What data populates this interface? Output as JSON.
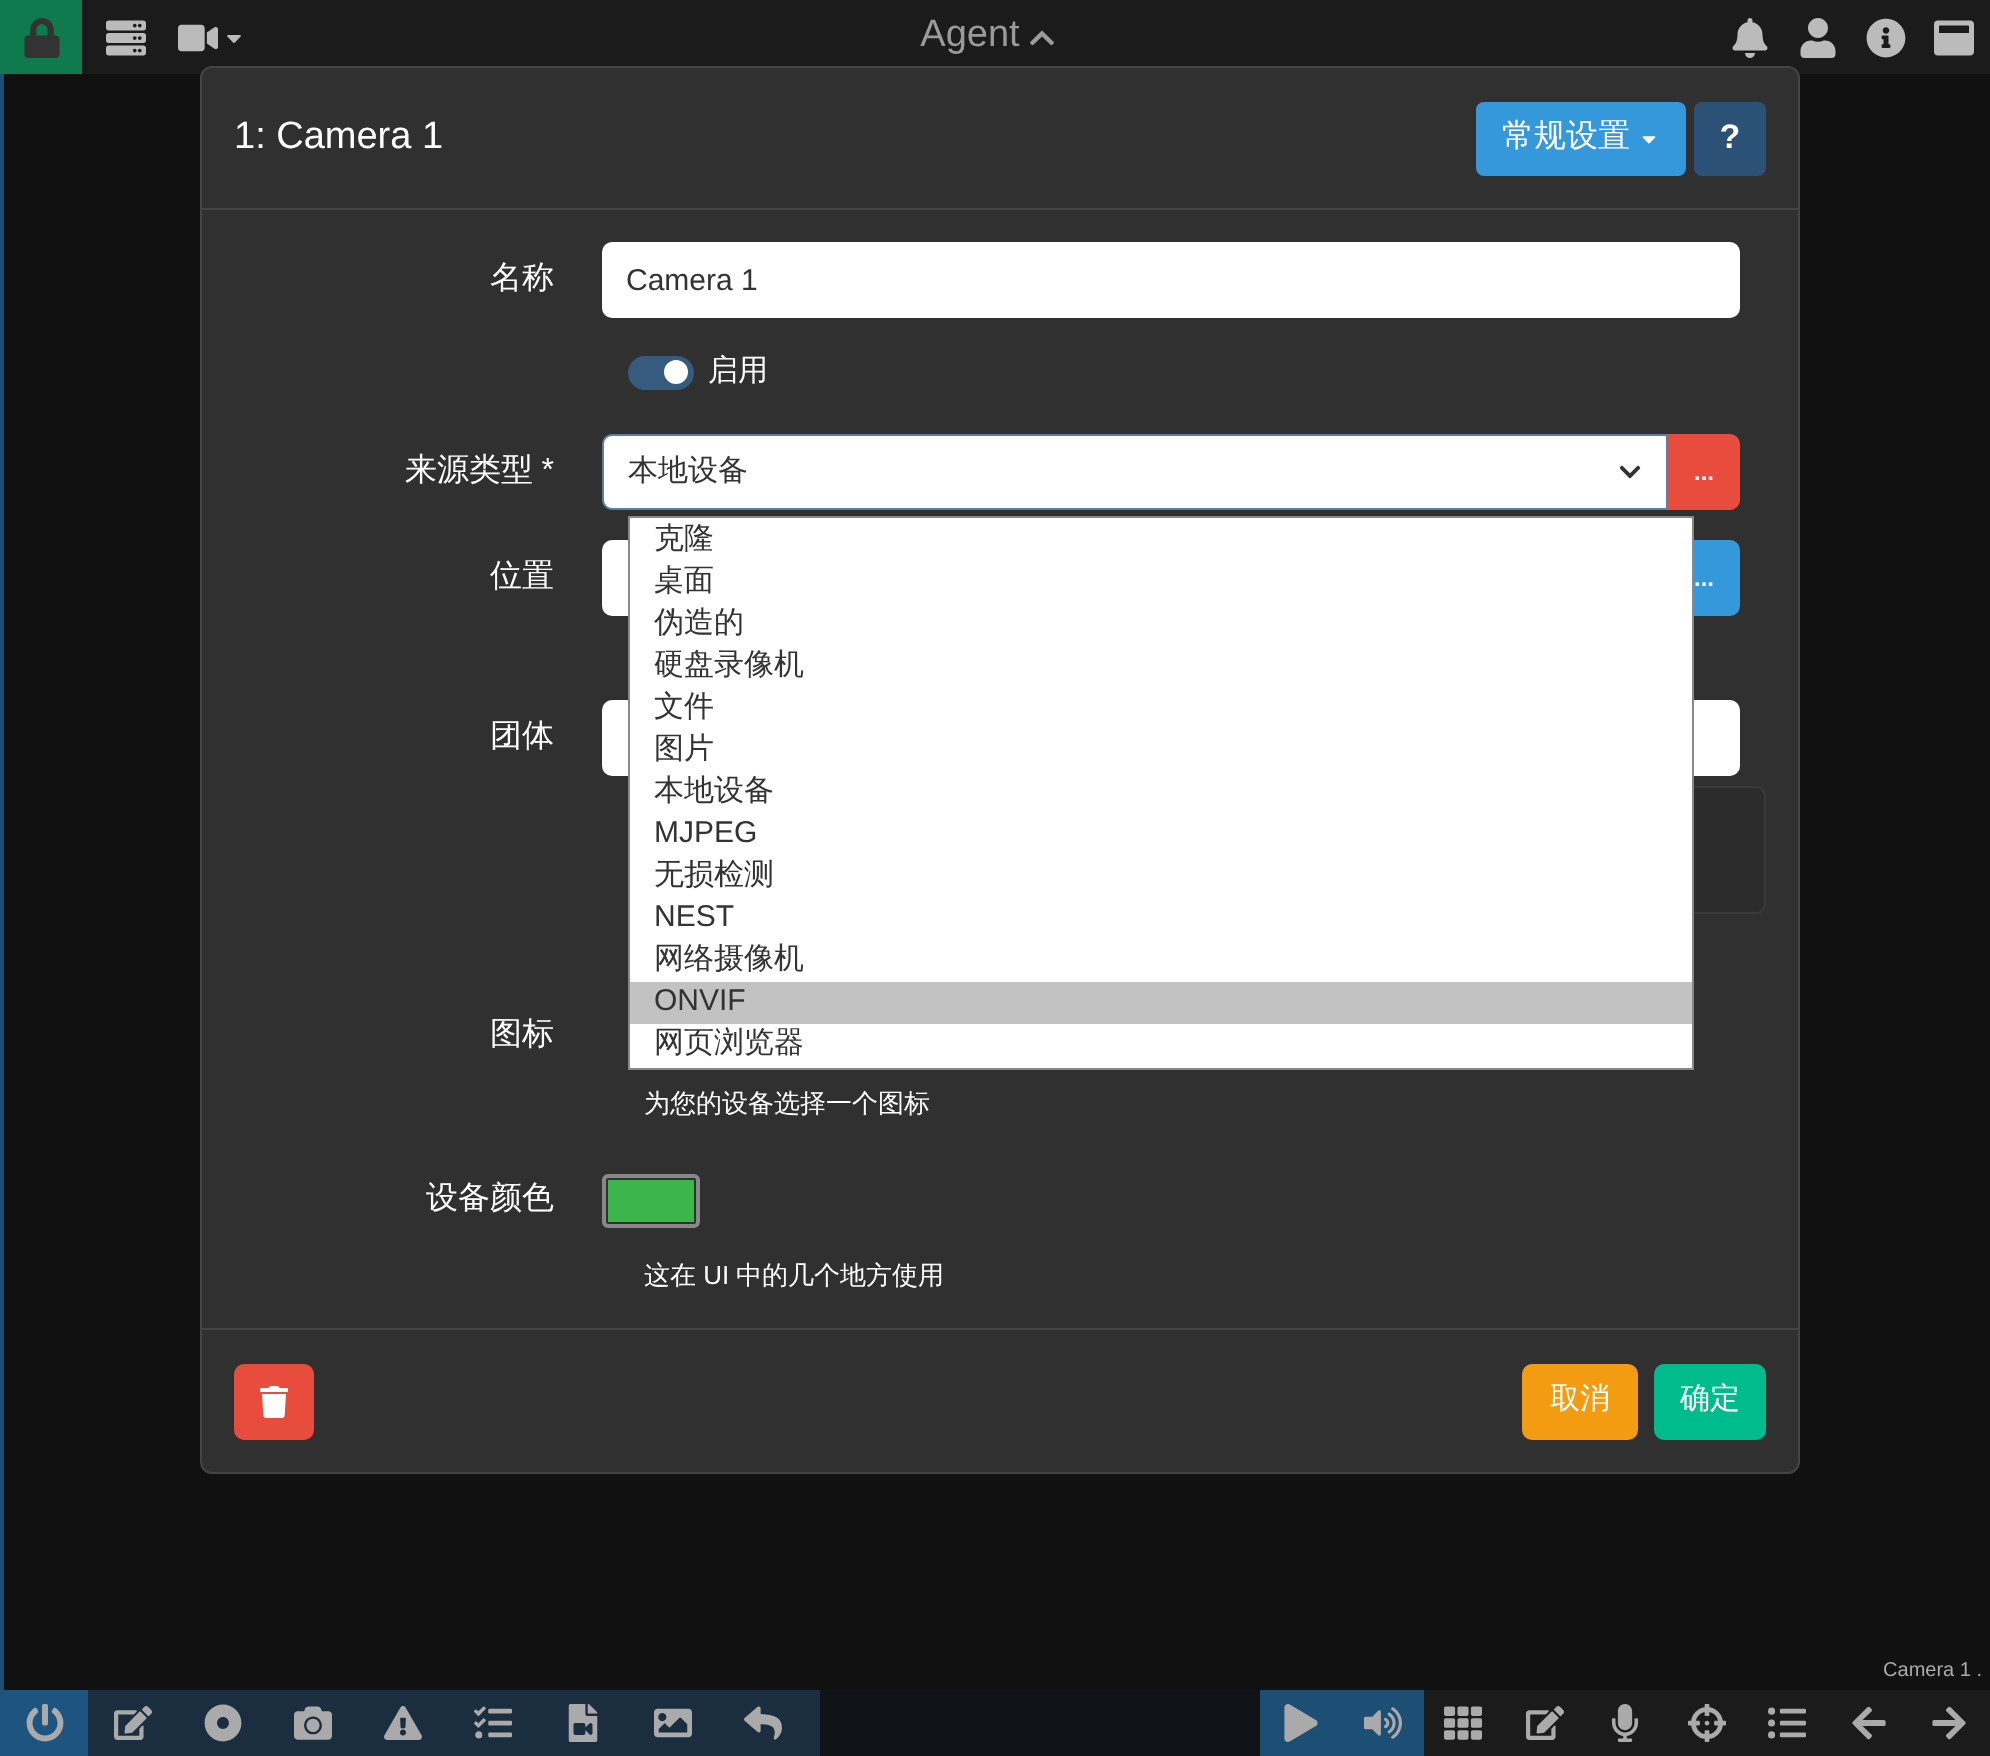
{
  "top_bar": {
    "title": "Agent"
  },
  "dialog": {
    "title": "1: Camera 1",
    "settings_button": "常规设置",
    "help_button": "?",
    "name": {
      "label": "名称",
      "value": "Camera 1"
    },
    "enabled": {
      "label": "启用",
      "on": true
    },
    "source": {
      "label": "来源类型 *",
      "value": "本地设备",
      "more_button": "..."
    },
    "location": {
      "label": "位置",
      "more_button": "..."
    },
    "group": {
      "label": "团体"
    },
    "icon": {
      "label": "图标",
      "hint": "为您的设备选择一个图标"
    },
    "color": {
      "label": "设备颜色",
      "color": "#3cb54a",
      "hint": "这在 UI 中的几个地方使用"
    },
    "cancel_button": "取消",
    "ok_button": "确定"
  },
  "dropdown": [
    {
      "label": "克隆",
      "selected": false
    },
    {
      "label": "桌面",
      "selected": false
    },
    {
      "label": "伪造的",
      "selected": false
    },
    {
      "label": "硬盘录像机",
      "selected": false
    },
    {
      "label": "文件",
      "selected": false
    },
    {
      "label": "图片",
      "selected": false
    },
    {
      "label": "本地设备",
      "selected": false
    },
    {
      "label": "MJPEG",
      "selected": false
    },
    {
      "label": "无损检测",
      "selected": false
    },
    {
      "label": "NEST",
      "selected": false
    },
    {
      "label": "网络摄像机",
      "selected": false
    },
    {
      "label": "ONVIF",
      "selected": true
    },
    {
      "label": "网页浏览器",
      "selected": false
    }
  ],
  "status_caption": "Camera 1 ."
}
